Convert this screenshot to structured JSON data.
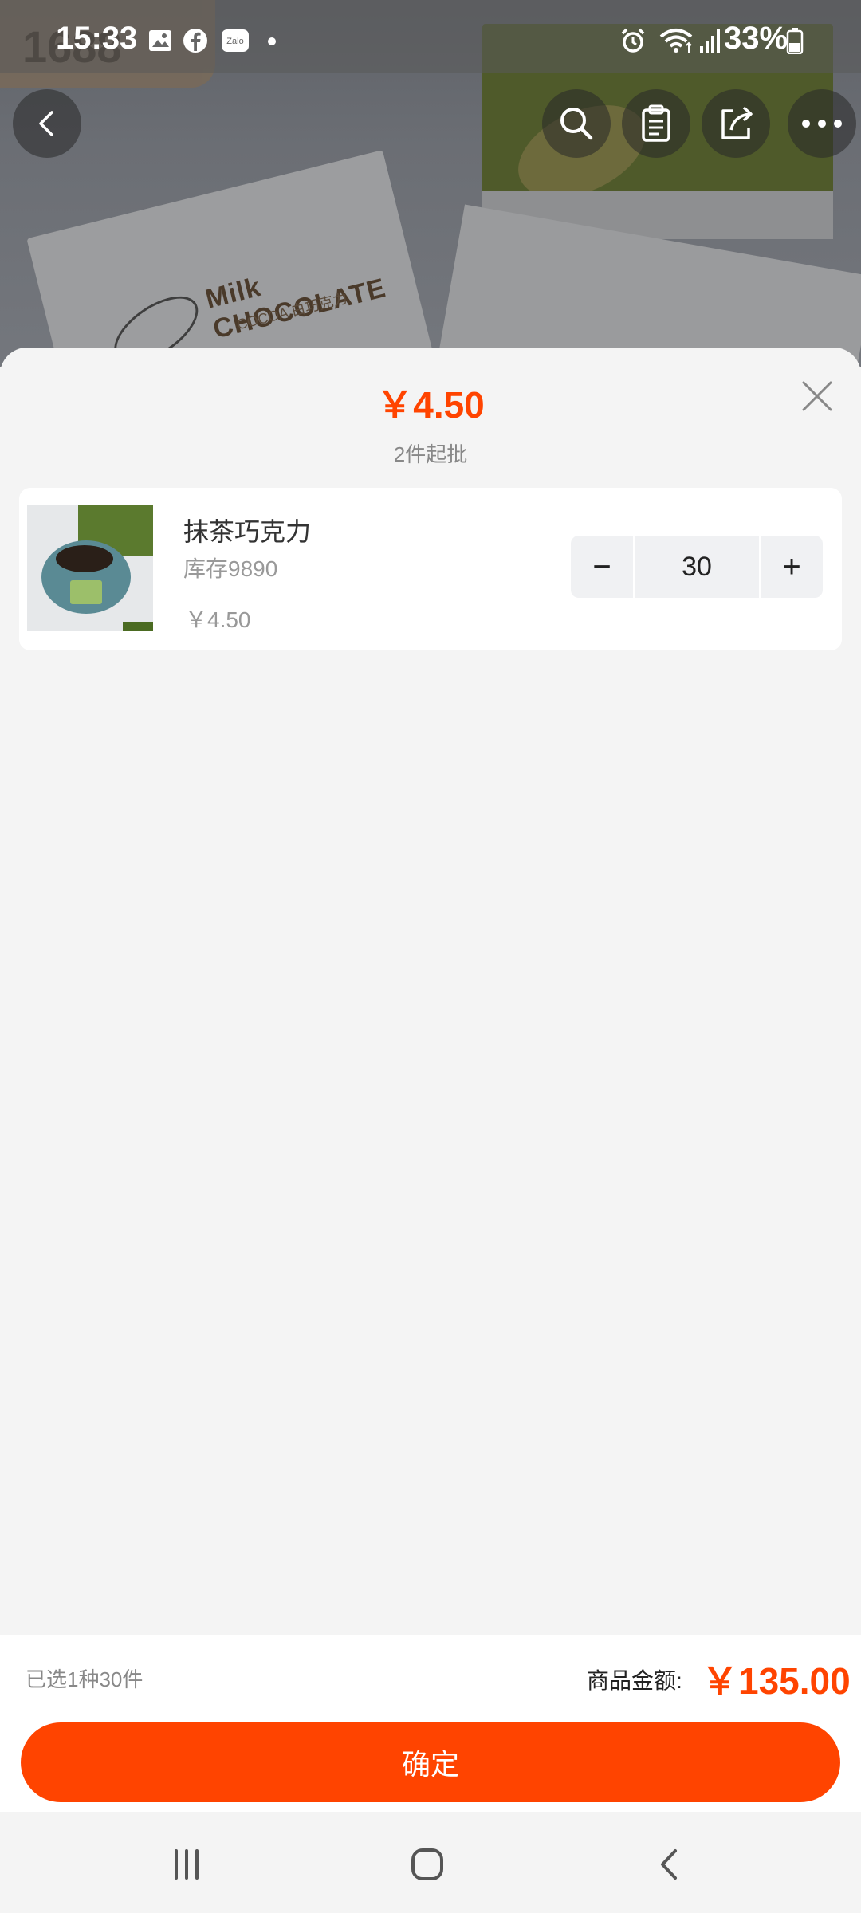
{
  "status_bar": {
    "time": "15:33",
    "battery": "33%",
    "notification_icons": [
      "image-icon",
      "facebook-icon",
      "zalo-icon",
      "dot-icon"
    ],
    "system_icons": [
      "alarm-icon",
      "wifi-icon",
      "signal-icon",
      "battery-icon"
    ]
  },
  "hero": {
    "partial_title": "1688",
    "box_label": "Milk CHOCOLATE",
    "box_sub": "COCOA 白巧克力"
  },
  "nav": {
    "buttons": [
      "back-icon",
      "search-icon",
      "clipboard-icon",
      "share-icon",
      "more-icon"
    ]
  },
  "sheet": {
    "price": "￥4.50",
    "moq": "2件起批",
    "item": {
      "name": "抹茶巧克力",
      "stock": "库存9890",
      "price": "￥4.50",
      "quantity": "30",
      "minus": "−",
      "plus": "+"
    }
  },
  "summary": {
    "selected": "已选1种30件",
    "total_label": "商品金额:",
    "total_value": "￥135.00",
    "confirm": "确定"
  },
  "colors": {
    "accent": "#ff4400",
    "sheet_bg": "#f4f4f4",
    "card_bg": "#ffffff"
  }
}
